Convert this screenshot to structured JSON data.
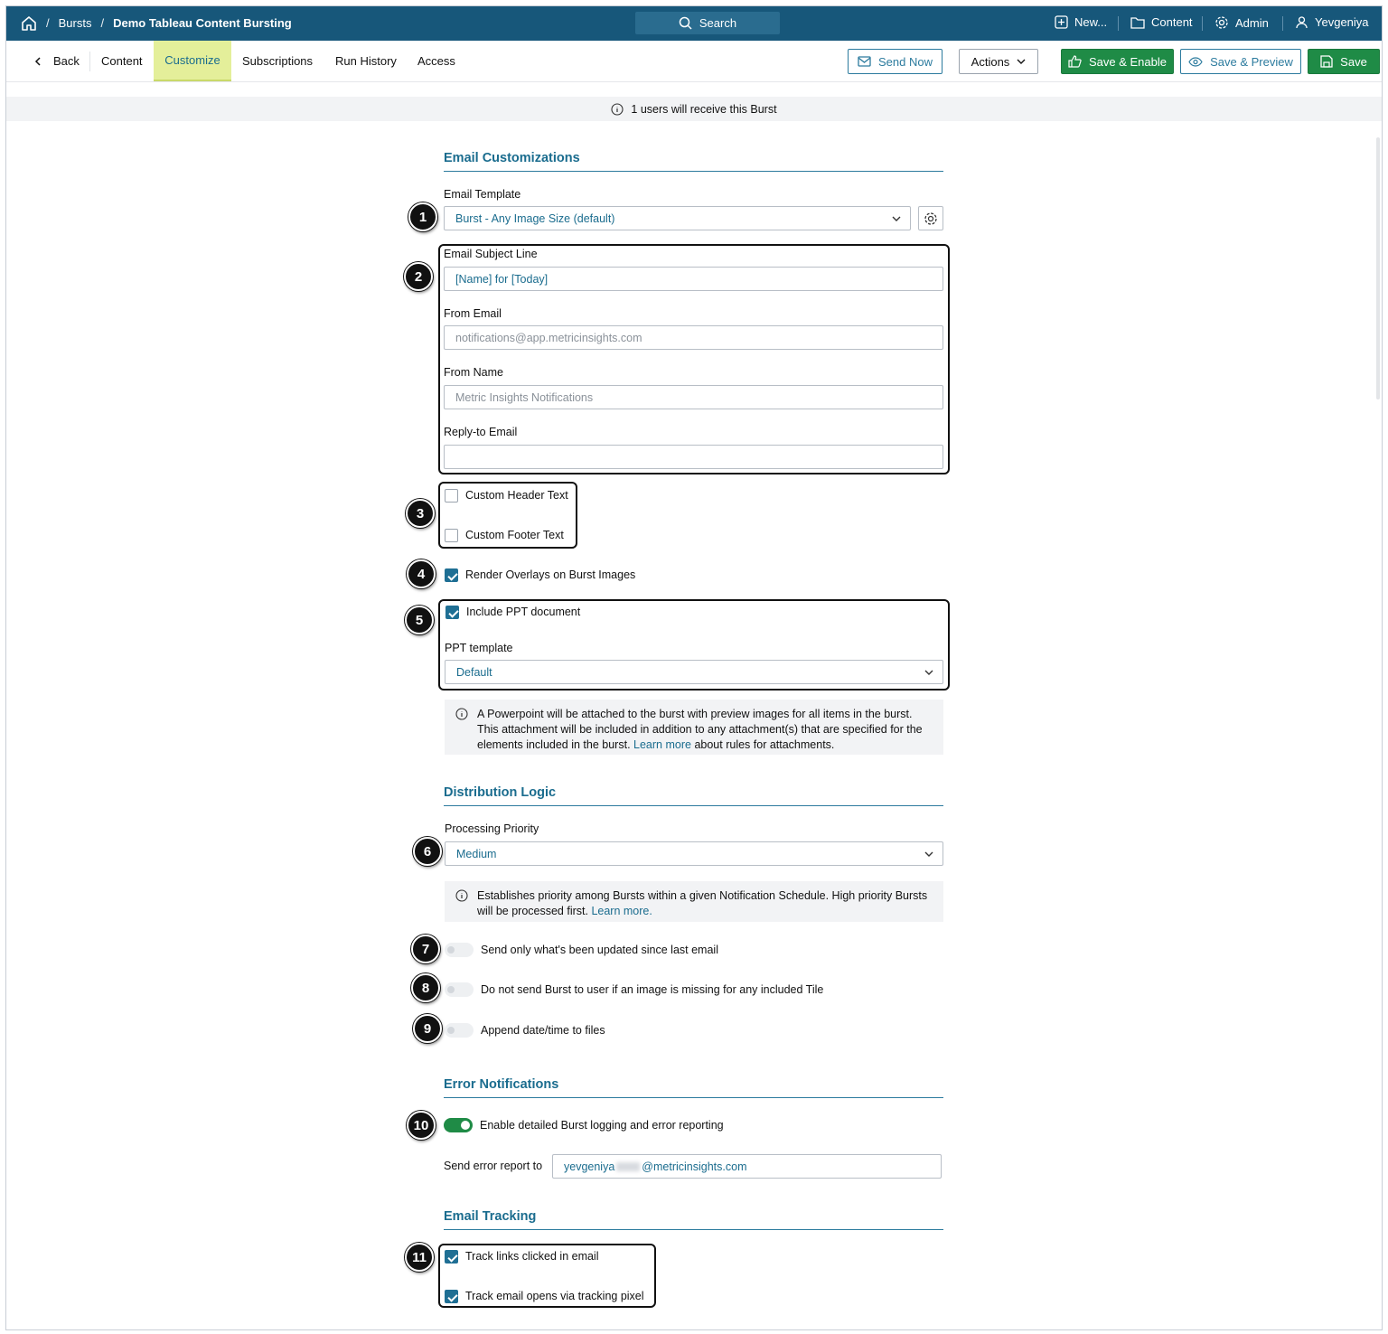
{
  "topbar": {
    "breadcrumb_bursts": "Bursts",
    "breadcrumb_sep": "/",
    "breadcrumb_current": "Demo Tableau Content Bursting",
    "search_label": "Search",
    "new_label": "New...",
    "content_label": "Content",
    "admin_label": "Admin",
    "user_label": "Yevgeniya"
  },
  "tabs": {
    "back": "Back",
    "content": "Content",
    "customize": "Customize",
    "subscriptions": "Subscriptions",
    "run_history": "Run History",
    "access": "Access"
  },
  "actions": {
    "send_now": "Send Now",
    "actions": "Actions",
    "save_enable": "Save & Enable",
    "save_preview": "Save & Preview",
    "save": "Save"
  },
  "notice": "1 users will receive this Burst",
  "email": {
    "section_title": "Email Customizations",
    "template_label": "Email Template",
    "template_value": "Burst - Any Image Size (default)",
    "subject_label": "Email Subject Line",
    "subject_value": "[Name] for [Today]",
    "from_email_label": "From Email",
    "from_email_placeholder": "notifications@app.metricinsights.com",
    "from_name_label": "From Name",
    "from_name_placeholder": "Metric Insights Notifications",
    "reply_to_label": "Reply-to Email",
    "reply_to_value": "",
    "custom_header": "Custom Header Text",
    "custom_footer": "Custom Footer Text",
    "render_overlays": "Render Overlays on Burst Images",
    "include_ppt": "Include PPT document",
    "ppt_template_label": "PPT template",
    "ppt_template_value": "Default",
    "ppt_info_1": "A Powerpoint will be attached to the burst with preview images for all items in the burst. This attachment will be included in addition to any attachment(s) that are specified for the elements included in the burst.",
    "ppt_info_link": "Learn more",
    "ppt_info_2": "about rules for attachments."
  },
  "distribution": {
    "section_title": "Distribution Logic",
    "priority_label": "Processing Priority",
    "priority_value": "Medium",
    "priority_info": "Establishes priority among Bursts within a given Notification Schedule. High priority Bursts will be processed first.",
    "priority_info_link": "Learn more.",
    "toggle_updated": "Send only what's been updated since last email",
    "toggle_missing": "Do not send Burst to user if an image is missing for any included Tile",
    "toggle_append": "Append date/time to files"
  },
  "errors": {
    "section_title": "Error Notifications",
    "enable_logging": "Enable detailed Burst logging and error reporting",
    "send_report_label": "Send error report to",
    "email_prefix": "yevgeniya",
    "email_suffix": "@metricinsights.com"
  },
  "tracking": {
    "section_title": "Email Tracking",
    "track_links": "Track links clicked in email",
    "track_opens": "Track email opens via tracking pixel"
  },
  "badges": [
    "1",
    "2",
    "3",
    "4",
    "5",
    "6",
    "7",
    "8",
    "9",
    "10",
    "11"
  ],
  "colors": {
    "topbar": "#17577a",
    "accent": "#1a6c8e",
    "green": "#1f8b46",
    "active_tab": "#e4ef9a"
  }
}
